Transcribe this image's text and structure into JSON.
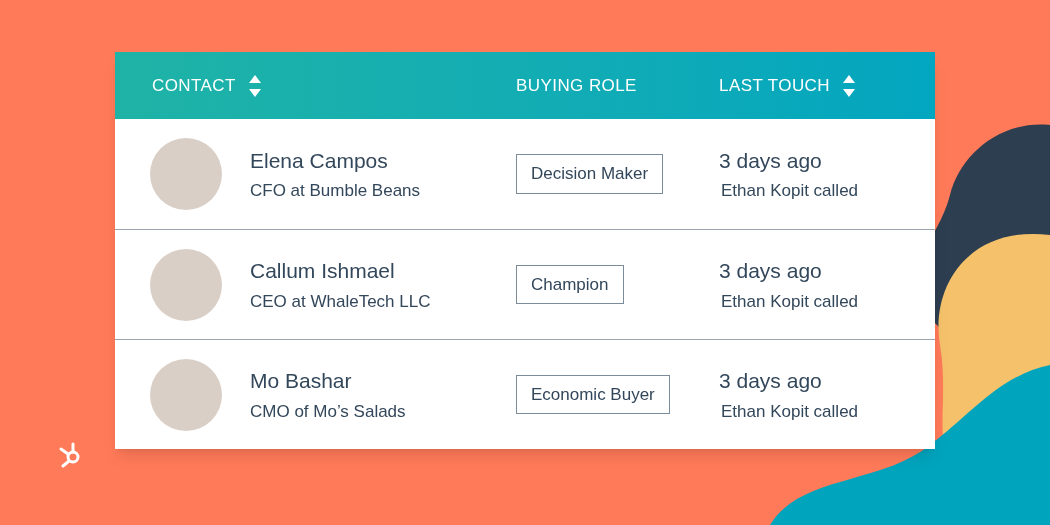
{
  "table": {
    "columns": [
      {
        "label": "CONTACT",
        "sortable": true
      },
      {
        "label": "BUYING ROLE",
        "sortable": false
      },
      {
        "label": "LAST TOUCH",
        "sortable": true
      }
    ],
    "rows": [
      {
        "name": "Elena Campos",
        "title": "CFO at Bumble Beans",
        "role": "Decision Maker",
        "when": "3 days ago",
        "activity": "Ethan Kopit called"
      },
      {
        "name": "Callum Ishmael",
        "title": "CEO at WhaleTech LLC",
        "role": "Champion",
        "when": "3 days ago",
        "activity": "Ethan Kopit called"
      },
      {
        "name": "Mo Bashar",
        "title": "CMO of Mo’s Salads",
        "role": "Economic Buyer",
        "when": "3 days ago",
        "activity": "Ethan Kopit called"
      }
    ]
  }
}
